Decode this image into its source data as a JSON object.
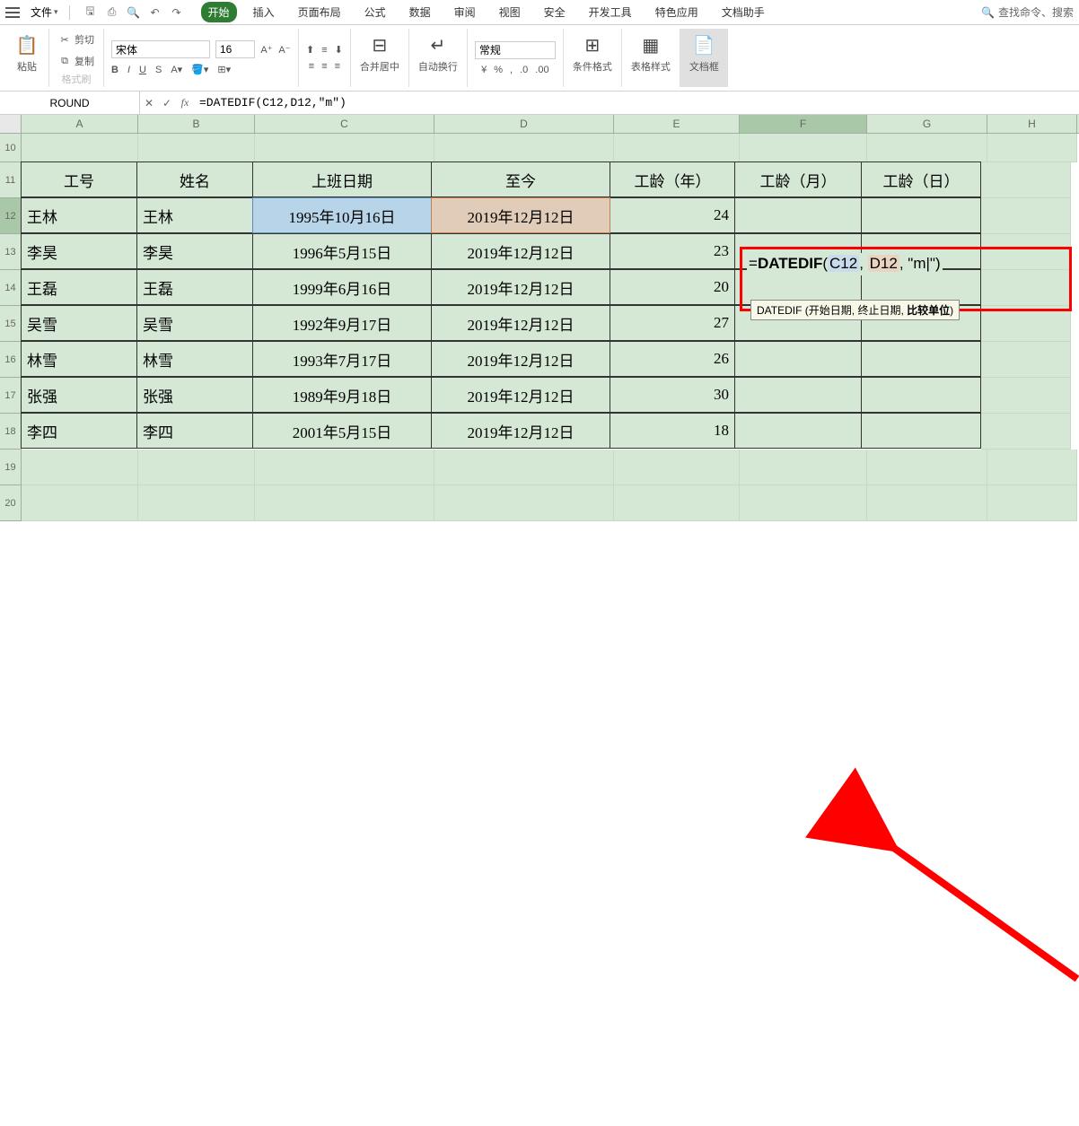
{
  "menubar": {
    "file": "文件",
    "tabs": [
      "开始",
      "插入",
      "页面布局",
      "公式",
      "数据",
      "审阅",
      "视图",
      "安全",
      "开发工具",
      "特色应用",
      "文档助手"
    ],
    "active_tab": 0,
    "search_placeholder": "查找命令、搜索"
  },
  "ribbon": {
    "paste": "粘贴",
    "cut": "剪切",
    "copy": "复制",
    "format_painter": "格式刷",
    "font_name": "宋体",
    "font_size": "16",
    "merge": "合并居中",
    "wrap": "自动换行",
    "general": "常规",
    "cond_format": "条件格式",
    "table_style": "表格样式",
    "doc_box": "文档框"
  },
  "formula_bar": {
    "namebox": "ROUND",
    "formula": "=DATEDIF(C12,D12,\"m\")"
  },
  "columns": [
    "A",
    "B",
    "C",
    "D",
    "E",
    "F",
    "G",
    "H"
  ],
  "visible_rows": [
    10,
    11,
    12,
    13,
    14,
    15,
    16,
    17,
    18,
    19,
    20
  ],
  "headers": {
    "A": "工号",
    "B": "姓名",
    "C": "上班日期",
    "D": "至今",
    "E": "工龄（年）",
    "F": "工龄（月）",
    "G": "工龄（日）"
  },
  "data": [
    {
      "A": "王林",
      "B": "王林",
      "C": "1995年10月16日",
      "D": "2019年12月12日",
      "E": "24"
    },
    {
      "A": "李昊",
      "B": "李昊",
      "C": "1996年5月15日",
      "D": "2019年12月12日",
      "E": "23"
    },
    {
      "A": "王磊",
      "B": "王磊",
      "C": "1999年6月16日",
      "D": "2019年12月12日",
      "E": "20"
    },
    {
      "A": "吴雪",
      "B": "吴雪",
      "C": "1992年9月17日",
      "D": "2019年12月12日",
      "E": "27"
    },
    {
      "A": "林雪",
      "B": "林雪",
      "C": "1993年7月17日",
      "D": "2019年12月12日",
      "E": "26"
    },
    {
      "A": "张强",
      "B": "张强",
      "C": "1989年9月18日",
      "D": "2019年12月12日",
      "E": "30"
    },
    {
      "A": "李四",
      "B": "李四",
      "C": "2001年5月15日",
      "D": "2019年12月12日",
      "E": "18"
    }
  ],
  "editing": {
    "cell": "F12",
    "prefix": "=",
    "fn": "DATEDIF",
    "open": "(",
    "arg1": "C12",
    "sep1": ", ",
    "arg2": "D12",
    "sep2": ", ",
    "arg3": "\"m|\")",
    "hint_fn": "DATEDIF ",
    "hint_args": "(开始日期, 终止日期, ",
    "hint_bold": "比较单位",
    "hint_close": ")"
  }
}
